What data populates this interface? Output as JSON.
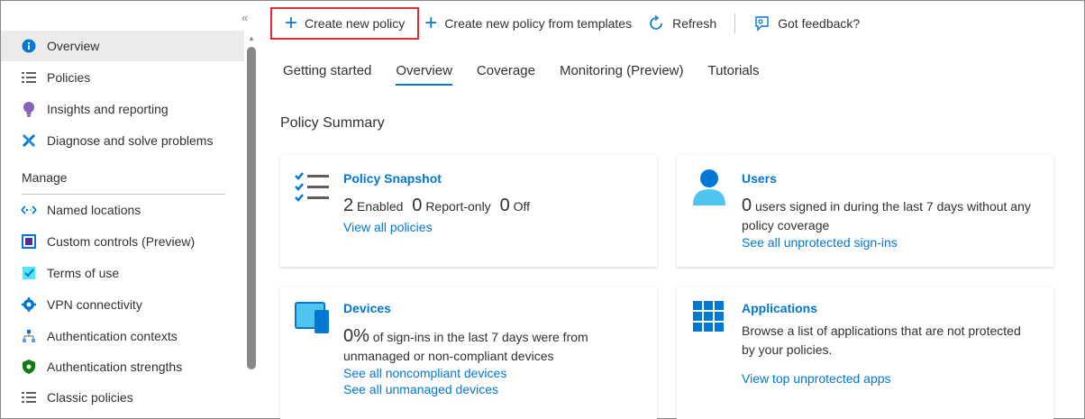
{
  "sidebar": {
    "collapse_glyph": "«",
    "items": [
      {
        "label": "Overview",
        "icon": "info-icon"
      },
      {
        "label": "Policies",
        "icon": "list-icon"
      },
      {
        "label": "Insights and reporting",
        "icon": "lightbulb-icon"
      },
      {
        "label": "Diagnose and solve problems",
        "icon": "wrench-icon"
      }
    ],
    "manage_label": "Manage",
    "manage_items": [
      {
        "label": "Named locations",
        "icon": "network-icon"
      },
      {
        "label": "Custom controls (Preview)",
        "icon": "custom-controls-icon"
      },
      {
        "label": "Terms of use",
        "icon": "terms-icon"
      },
      {
        "label": "VPN connectivity",
        "icon": "gear-icon"
      },
      {
        "label": "Authentication contexts",
        "icon": "hierarchy-icon"
      },
      {
        "label": "Authentication strengths",
        "icon": "shield-icon"
      },
      {
        "label": "Classic policies",
        "icon": "list-icon"
      }
    ]
  },
  "toolbar": {
    "create_new_policy": "Create new policy",
    "create_from_templates": "Create new policy from templates",
    "refresh": "Refresh",
    "feedback": "Got feedback?"
  },
  "tabs": [
    "Getting started",
    "Overview",
    "Coverage",
    "Monitoring (Preview)",
    "Tutorials"
  ],
  "active_tab": "Overview",
  "summary_title": "Policy Summary",
  "cards": {
    "snapshot": {
      "title": "Policy Snapshot",
      "enabled_count": "2",
      "enabled_label": "Enabled",
      "report_count": "0",
      "report_label": "Report-only",
      "off_count": "0",
      "off_label": "Off",
      "link": "View all policies"
    },
    "users": {
      "title": "Users",
      "count": "0",
      "text_line1": "users signed in during the last 7 days without any",
      "text_line2": "policy coverage",
      "link": "See all unprotected sign-ins"
    },
    "devices": {
      "title": "Devices",
      "percent": "0%",
      "text_line1": "of sign-ins in the last 7 days were from",
      "text_line2": "unmanaged or non-compliant devices",
      "link1": "See all noncompliant devices",
      "link2": "See all unmanaged devices"
    },
    "applications": {
      "title": "Applications",
      "text_line1": "Browse a list of applications that are not protected",
      "text_line2": "by your policies.",
      "link": "View top unprotected apps"
    }
  },
  "colors": {
    "accent": "#0078d4",
    "highlight_border": "#e02d2d",
    "active_bg": "#edebe9"
  }
}
